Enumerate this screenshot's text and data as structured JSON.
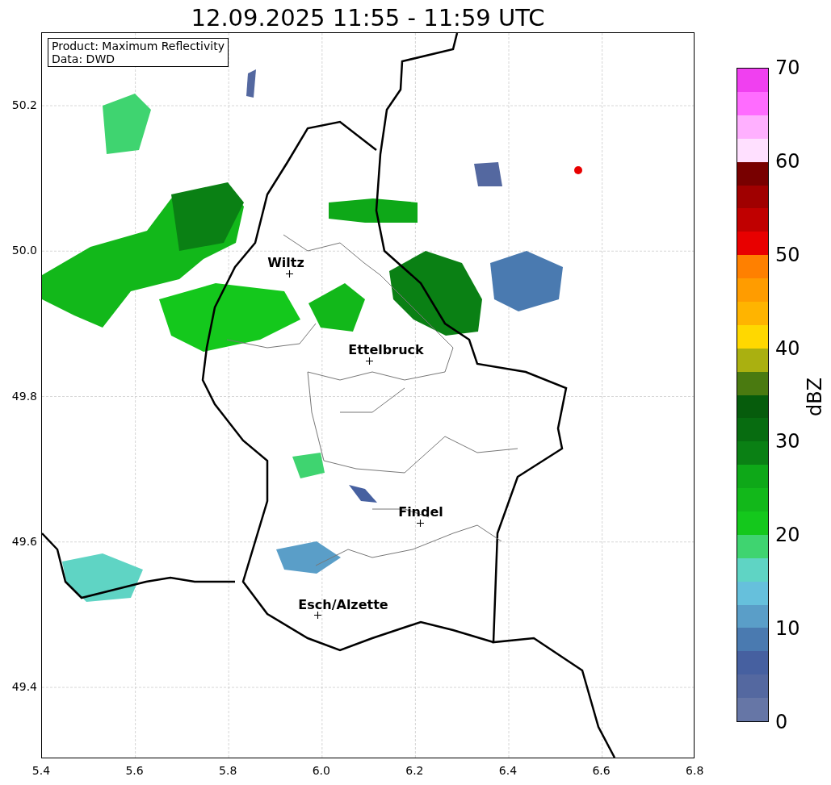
{
  "title": "12.09.2025 11:55 - 11:59 UTC",
  "info_box": [
    "Product: Maximum Reflectivity",
    "Data: DWD"
  ],
  "map": {
    "x_ticks": [
      "5.4",
      "5.6",
      "5.8",
      "6.0",
      "6.2",
      "6.4",
      "6.6",
      "6.8"
    ],
    "y_ticks": [
      "50.2",
      "50.0",
      "49.8",
      "49.6",
      "49.4"
    ],
    "cities": [
      {
        "name": "Wiltz"
      },
      {
        "name": "Ettelbruck"
      },
      {
        "name": "Findel"
      },
      {
        "name": "Esch/Alzette"
      }
    ]
  },
  "colorbar": {
    "label": "dBZ",
    "ticks": [
      "70",
      "60",
      "50",
      "40",
      "30",
      "20",
      "10",
      "0"
    ],
    "bands": [
      {
        "color": "#6676a6"
      },
      {
        "color": "#5468a0"
      },
      {
        "color": "#4660a0"
      },
      {
        "color": "#4a7ab0"
      },
      {
        "color": "#5a9ec8"
      },
      {
        "color": "#66c0dc"
      },
      {
        "color": "#5fd4c4"
      },
      {
        "color": "#3fd470"
      },
      {
        "color": "#14c81c"
      },
      {
        "color": "#12b81a"
      },
      {
        "color": "#0ea818"
      },
      {
        "color": "#0a8014"
      },
      {
        "color": "#076c10"
      },
      {
        "color": "#065c0c"
      },
      {
        "color": "#4a7a10"
      },
      {
        "color": "#aab010"
      },
      {
        "color": "#ffd800"
      },
      {
        "color": "#ffb400"
      },
      {
        "color": "#ff9c00"
      },
      {
        "color": "#ff8000"
      },
      {
        "color": "#e80000"
      },
      {
        "color": "#c00000"
      },
      {
        "color": "#a00000"
      },
      {
        "color": "#780000"
      },
      {
        "color": "#ffe0ff"
      },
      {
        "color": "#ffb0ff"
      },
      {
        "color": "#ff6cff"
      },
      {
        "color": "#f040f0"
      }
    ]
  }
}
